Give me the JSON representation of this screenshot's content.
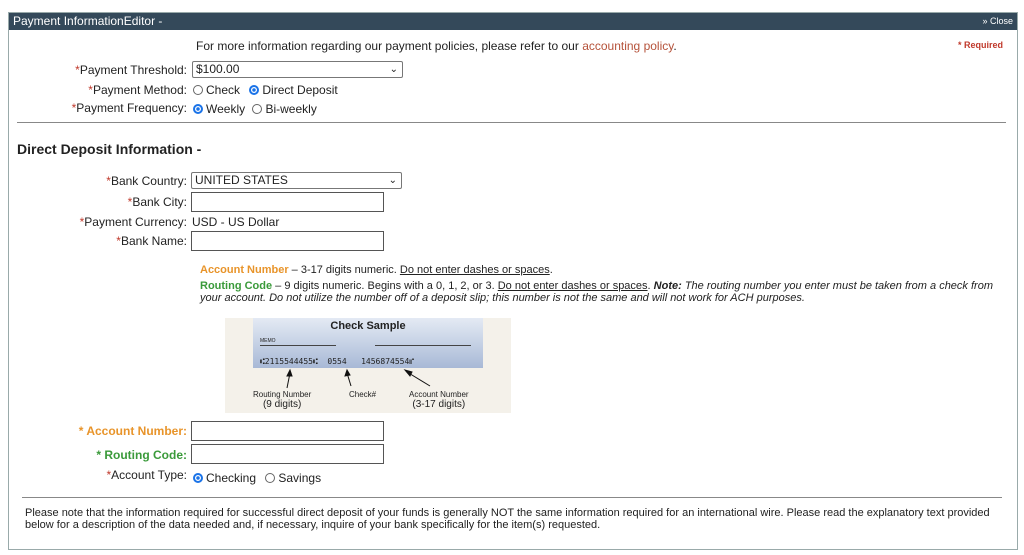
{
  "window": {
    "title": "Payment InformationEditor -",
    "close": "» Close"
  },
  "intro": {
    "text": "For more information regarding our payment policies, please refer to our ",
    "link": "accounting policy",
    "period": ".",
    "required": "* Required"
  },
  "payment": {
    "threshold_label": "Payment Threshold:",
    "threshold_value": "$100.00",
    "method_label": "Payment Method:",
    "method_options": [
      "Check",
      "Direct Deposit"
    ],
    "method_selected": "Direct Deposit",
    "frequency_label": "Payment Frequency:",
    "frequency_options": [
      "Weekly",
      "Bi-weekly"
    ],
    "frequency_selected": "Weekly"
  },
  "deposit": {
    "heading": "Direct Deposit Information -",
    "country_label": "Bank Country:",
    "country_value": "UNITED STATES",
    "city_label": "Bank City:",
    "currency_label": "Payment Currency:",
    "currency_value": "USD - US Dollar",
    "name_label": "Bank Name:"
  },
  "help": {
    "acct_title": "Account Number",
    "acct_text": " – 3-17 digits numeric. ",
    "acct_u": "Do not enter dashes or spaces",
    "routing_title": "Routing Code",
    "routing_text": " – 9 digits numeric. Begins with a 0, 1, 2, or 3. ",
    "routing_u": "Do not enter dashes or spaces",
    "note_label": "Note:",
    "note_text": " The routing number you enter must be taken from a check from your account. Do not utilize the number off of a deposit slip; this number is not the same and will not work for ACH purposes."
  },
  "check_sample": {
    "title": "Check Sample",
    "memo": "MEMO",
    "micr": "⑆2115544455⑆  0554   1456874554⑈",
    "routing_label": "Routing Number",
    "routing_digits": "(9 digits)",
    "check_label": "Check#",
    "account_label": "Account Number",
    "account_digits": "(3-17 digits)"
  },
  "fields": {
    "account_label": "Account Number:",
    "routing_label": "Routing Code:",
    "type_label": "Account Type:",
    "type_options": [
      "Checking",
      "Savings"
    ],
    "type_selected": "Checking"
  },
  "footer": {
    "note": "Please note that the information required for successful direct deposit of your funds is generally NOT the same information required for an international wire. Please read the explanatory text provided below for a description of the data needed and, if necessary, inquire of your bank specifically for the item(s) requested."
  },
  "colors": {
    "titlebar": "#34495a",
    "required": "#c0392b",
    "account": "#e8942a",
    "routing": "#3a9a3a",
    "link": "#b5523a"
  }
}
